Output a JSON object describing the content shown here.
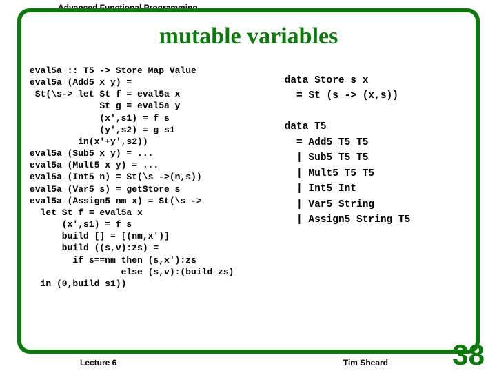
{
  "header_label": "Advanced Functional Programming",
  "title": "mutable variables",
  "left_code": "eval5a :: T5 -> Store Map Value\neval5a (Add5 x y) =\n St(\\s-> let St f = eval5a x\n             St g = eval5a y\n             (x',s1) = f s\n             (y',s2) = g s1\n         in(x'+y',s2))\neval5a (Sub5 x y) = ...\neval5a (Mult5 x y) = ...\neval5a (Int5 n) = St(\\s ->(n,s))\neval5a (Var5 s) = getStore s\neval5a (Assign5 nm x) = St(\\s ->\n  let St f = eval5a x\n      (x',s1) = f s\n      build [] = [(nm,x')]\n      build ((s,v):zs) =\n        if s==nm then (s,x'):zs\n                 else (s,v):(build zs)\n  in (0,build s1))",
  "right_code": "data Store s x\n  = St (s -> (x,s))\n\ndata T5\n  = Add5 T5 T5\n  | Sub5 T5 T5\n  | Mult5 T5 T5\n  | Int5 Int\n  | Var5 String\n  | Assign5 String T5",
  "footer_left": "Lecture 6",
  "footer_right": "Tim Sheard",
  "page_number": "38"
}
